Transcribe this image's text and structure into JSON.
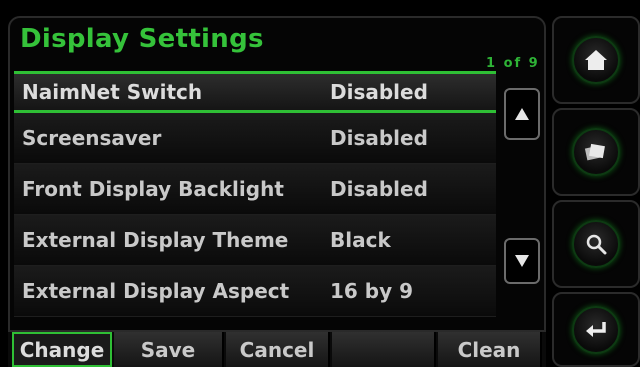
{
  "header": {
    "title": "Display Settings",
    "page_indicator": "1 of 9"
  },
  "settings": [
    {
      "label": "NaimNet Switch",
      "value": "Disabled",
      "selected": true
    },
    {
      "label": "Screensaver",
      "value": "Disabled",
      "selected": false
    },
    {
      "label": "Front Display Backlight",
      "value": "Disabled",
      "selected": false
    },
    {
      "label": "External Display Theme",
      "value": "Black",
      "selected": false
    },
    {
      "label": "External Display Aspect",
      "value": "16 by 9",
      "selected": false
    }
  ],
  "bottom_tabs": [
    {
      "label": "Change",
      "active": true
    },
    {
      "label": "Save",
      "active": false
    },
    {
      "label": "Cancel",
      "active": false
    },
    {
      "label": "",
      "active": false
    },
    {
      "label": "Clean",
      "active": false
    }
  ],
  "side_buttons": [
    {
      "icon": "home-icon"
    },
    {
      "icon": "albums-icon"
    },
    {
      "icon": "search-icon"
    },
    {
      "icon": "enter-icon"
    }
  ],
  "colors": {
    "accent": "#2fbf35",
    "text": "#c9c9c9",
    "background": "#000000"
  }
}
